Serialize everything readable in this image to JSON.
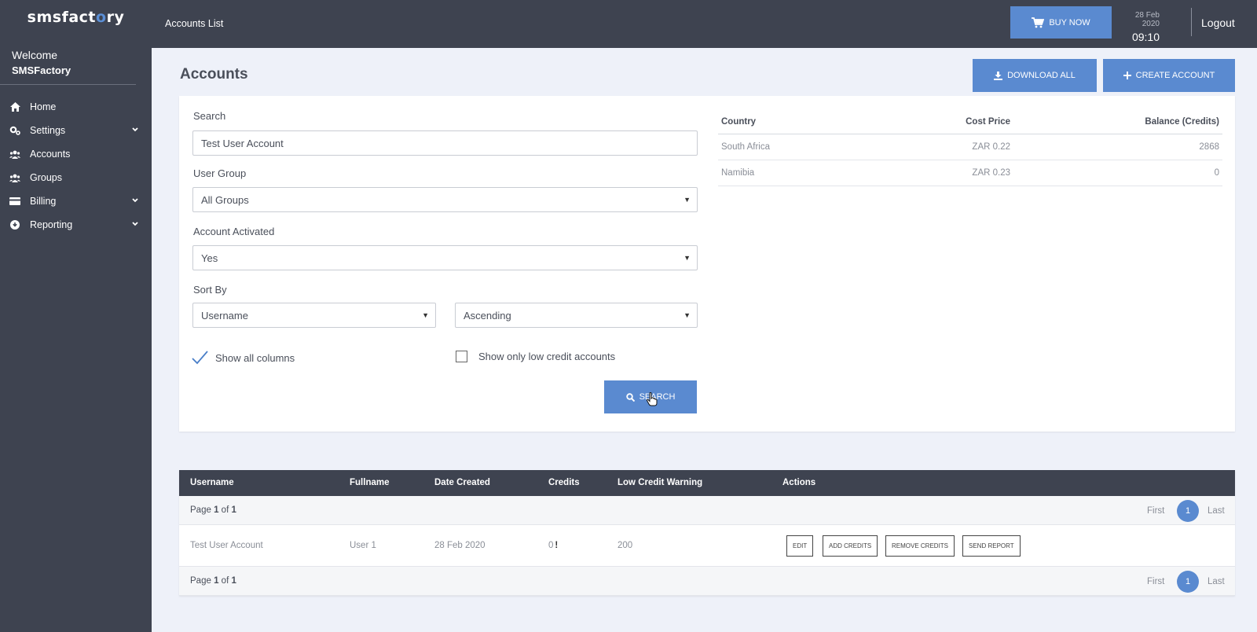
{
  "brand": {
    "logo_pre": "smsfact",
    "logo_o": "o",
    "logo_post": "ry"
  },
  "sidebar": {
    "welcome": "Welcome",
    "user": "SMSFactory",
    "items": [
      {
        "label": "Home",
        "icon": "home-icon"
      },
      {
        "label": "Settings",
        "icon": "cogs-icon"
      },
      {
        "label": "Accounts",
        "icon": "users-icon"
      },
      {
        "label": "Groups",
        "icon": "users-icon"
      },
      {
        "label": "Billing",
        "icon": "card-icon"
      },
      {
        "label": "Reporting",
        "icon": "download-circle-icon"
      }
    ]
  },
  "header": {
    "breadcrumb": "Accounts List",
    "buy_now": "BUY NOW",
    "date": "28 Feb 2020",
    "time": "09:10",
    "logout": "Logout"
  },
  "page": {
    "title": "Accounts",
    "download_all": "DOWNLOAD ALL",
    "create_account": "CREATE ACCOUNT"
  },
  "filters": {
    "search_label": "Search",
    "search_value": "Test User Account",
    "user_group_label": "User Group",
    "user_group_value": "All Groups",
    "activated_label": "Account Activated",
    "activated_value": "Yes",
    "sort_label": "Sort By",
    "sort_field": "Username",
    "sort_order": "Ascending",
    "show_all_columns": "Show all columns",
    "show_low_credit": "Show only low credit accounts",
    "search_button": "SEARCH"
  },
  "pricing": {
    "headers": [
      "Country",
      "Cost Price",
      "Balance (Credits)"
    ],
    "rows": [
      [
        "South Africa",
        "ZAR 0.22",
        "2868"
      ],
      [
        "Namibia",
        "ZAR 0.23",
        "0"
      ]
    ]
  },
  "accounts": {
    "headers": [
      "Username",
      "Fullname",
      "Date Created",
      "Credits",
      "Low Credit Warning",
      "Actions"
    ],
    "page_label_pre": "Page",
    "page_current": "1",
    "page_of": "of",
    "page_total": "1",
    "first": "First",
    "last": "Last",
    "page_num": "1",
    "rows": [
      {
        "username": "Test User Account",
        "fullname": "User 1",
        "date_created": "28 Feb 2020",
        "credits": "0",
        "credit_flag": "!",
        "low_credit_warning": "200",
        "actions": [
          "EDIT",
          "ADD CREDITS",
          "REMOVE CREDITS",
          "SEND REPORT"
        ]
      }
    ]
  },
  "colors": {
    "sidebar": "#3e4350",
    "accent": "#5a8ad0",
    "background": "#eef1f9"
  }
}
